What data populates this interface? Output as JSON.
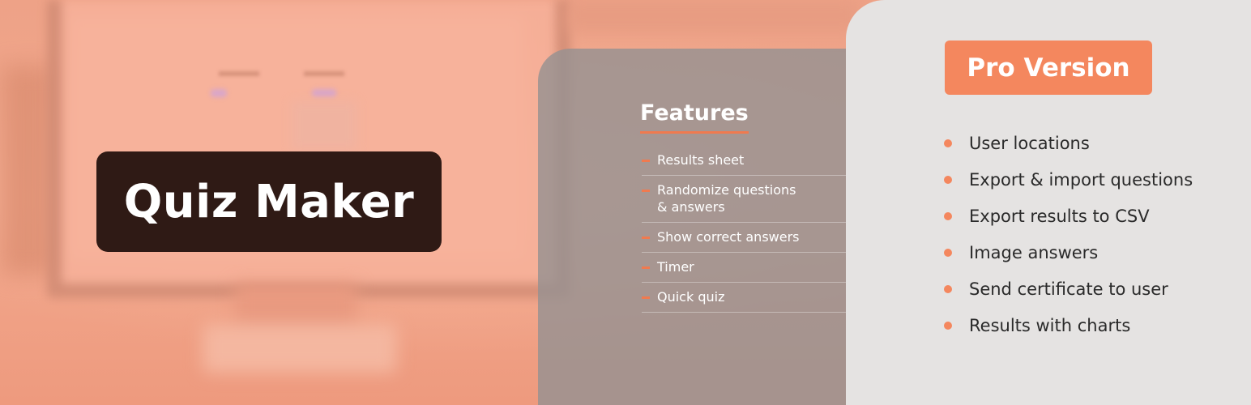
{
  "title": "Quiz Maker",
  "features": {
    "heading": "Features",
    "items": [
      "Results sheet",
      "Randomize questions\n& answers",
      "Show correct answers",
      "Timer",
      "Quick quiz"
    ]
  },
  "pro": {
    "badge": "Pro Version",
    "items": [
      "User locations",
      "Export & import questions",
      "Export results to CSV",
      "Image answers",
      "Send certificate to user",
      "Results with charts"
    ]
  },
  "colors": {
    "accent": "#f4875e",
    "title_box": "#2f1a15",
    "pro_panel": "#e5e3e2"
  }
}
